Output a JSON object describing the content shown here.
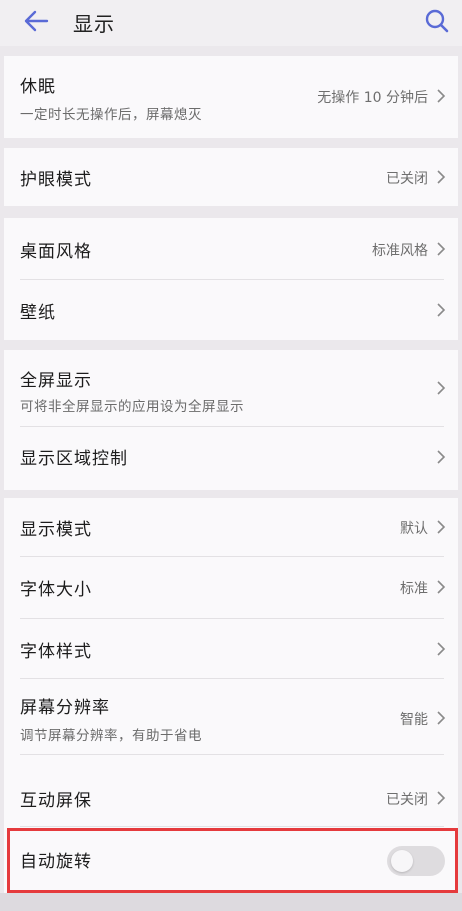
{
  "header": {
    "title": "显示",
    "back_icon": "back-arrow-icon",
    "search_icon": "search-icon",
    "accent_color": "#5a6ad6"
  },
  "items": [
    {
      "label": "休眠",
      "subtitle": "一定时长无操作后，屏幕熄灭",
      "value": "无操作 10 分钟后"
    },
    {
      "label": "护眼模式",
      "value": "已关闭"
    },
    {
      "label": "桌面风格",
      "value": "标准风格"
    },
    {
      "label": "壁纸"
    },
    {
      "label": "全屏显示",
      "subtitle": "可将非全屏显示的应用设为全屏显示"
    },
    {
      "label": "显示区域控制"
    },
    {
      "label": "显示模式",
      "value": "默认"
    },
    {
      "label": "字体大小",
      "value": "标准"
    },
    {
      "label": "字体样式"
    },
    {
      "label": "屏幕分辨率",
      "subtitle": "调节屏幕分辨率，有助于省电",
      "value": "智能"
    },
    {
      "label": "互动屏保",
      "value": "已关闭"
    },
    {
      "label": "自动旋转",
      "toggle_on": false
    }
  ],
  "highlight_color": "#e53a3d"
}
